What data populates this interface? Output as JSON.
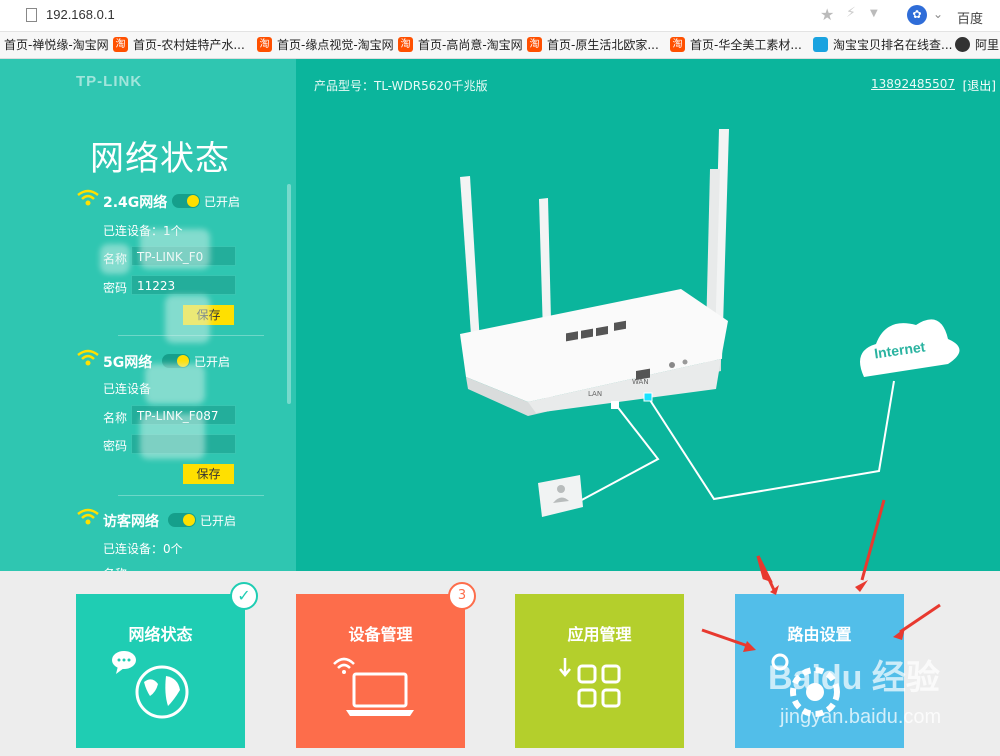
{
  "browser": {
    "url": "192.168.0.1",
    "search_engine": "百度",
    "bookmarks": [
      {
        "label": "首页-禅悦缘-淘宝网",
        "icon": ""
      },
      {
        "label": "首页-农村娃特产水...",
        "icon": "淘"
      },
      {
        "label": "首页-缘点视觉-淘宝网",
        "icon": "淘"
      },
      {
        "label": "首页-高尚意-淘宝网",
        "icon": "淘"
      },
      {
        "label": "首页-原生活北欧家...",
        "icon": "淘"
      },
      {
        "label": "首页-华全美工素材...",
        "icon": "淘"
      },
      {
        "label": "淘宝宝贝排名在线查...",
        "icon": ""
      },
      {
        "label": "阿里",
        "icon": ""
      }
    ]
  },
  "app": {
    "logo": "TP-LINK",
    "page_title": "网络状态",
    "model_label": "产品型号：TL-WDR5620千兆版",
    "user": "13892485507",
    "logout": "[退出]"
  },
  "sections": {
    "g24": {
      "name": "2.4G网络",
      "status": "已开启",
      "connected": "已连设备：1个",
      "ssid_label": "名称",
      "ssid": "TP-LINK_F0",
      "pwd_label": "密码",
      "pwd": "11223",
      "save": "保存"
    },
    "g5": {
      "name": "5G网络",
      "status": "已开启",
      "connected": "已连设备",
      "ssid_label": "名称",
      "ssid": "TP-LINK_F087",
      "pwd_label": "密码",
      "pwd": "",
      "save": "保存"
    },
    "guest": {
      "name": "访客网络",
      "status": "已开启",
      "connected": "已连设备：0个",
      "ssid_label": "名称"
    }
  },
  "diagram": {
    "internet": "Internet",
    "lan": "LAN",
    "wan": "WAN"
  },
  "tiles": [
    {
      "label": "网络状态"
    },
    {
      "label": "设备管理",
      "badge": "3"
    },
    {
      "label": "应用管理"
    },
    {
      "label": "路由设置"
    }
  ],
  "watermark": {
    "brand": "Baidu 经验",
    "url": "jingyan.baidu.com"
  },
  "colors": {
    "sidebar": "#2fc6b1",
    "main": "#0bb59c",
    "tile_status": "#1fcdb3",
    "tile_devices": "#fd6d4b",
    "tile_apps": "#b4cf2c",
    "tile_settings": "#52bee9",
    "annotation_arrow": "#e8392f"
  }
}
